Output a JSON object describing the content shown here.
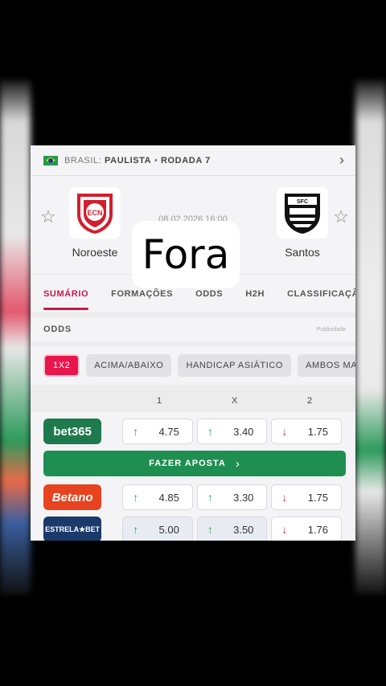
{
  "breadcrumb": {
    "country": "BRASIL:",
    "league": "PAULISTA",
    "sep": "•",
    "round": "RODADA 7"
  },
  "match": {
    "datetime": "08.02.2026 16:00",
    "overlay_text": "Fora",
    "home": {
      "name": "Noroeste",
      "logo_text": "ECN"
    },
    "away": {
      "name": "Santos",
      "logo_text": "SFC"
    }
  },
  "tabs": [
    "SUMÁRIO",
    "FORMAÇÕES",
    "ODDS",
    "H2H",
    "CLASSIFICAÇÃO"
  ],
  "odds_section": {
    "title": "ODDS",
    "ad_label": "Publicidade"
  },
  "markets": [
    "1X2",
    "ACIMA/ABAIXO",
    "HANDICAP ASIÁTICO",
    "AMBOS MA"
  ],
  "columns": [
    "1",
    "X",
    "2"
  ],
  "bookmakers": [
    {
      "name": "bet365",
      "color": "#1e7a4c",
      "odds": [
        {
          "v": "4.75",
          "dir": "up"
        },
        {
          "v": "3.40",
          "dir": "up"
        },
        {
          "v": "1.75",
          "dir": "down"
        }
      ]
    },
    {
      "name": "Betano",
      "color": "#e8431f",
      "odds": [
        {
          "v": "4.85",
          "dir": "up"
        },
        {
          "v": "3.30",
          "dir": "up"
        },
        {
          "v": "1.75",
          "dir": "down"
        }
      ]
    },
    {
      "name": "ESTRELA★BET",
      "color": "#1b3a6b",
      "odds": [
        {
          "v": "5.00",
          "dir": "up"
        },
        {
          "v": "3.50",
          "dir": "up"
        },
        {
          "v": "1.76",
          "dir": "down"
        }
      ]
    }
  ],
  "bet_button": {
    "label": "FAZER APOSTA"
  },
  "colors": {
    "accent": "#c8184a",
    "green": "#1f8f51",
    "up": "#2ca463",
    "down": "#c0334e"
  }
}
